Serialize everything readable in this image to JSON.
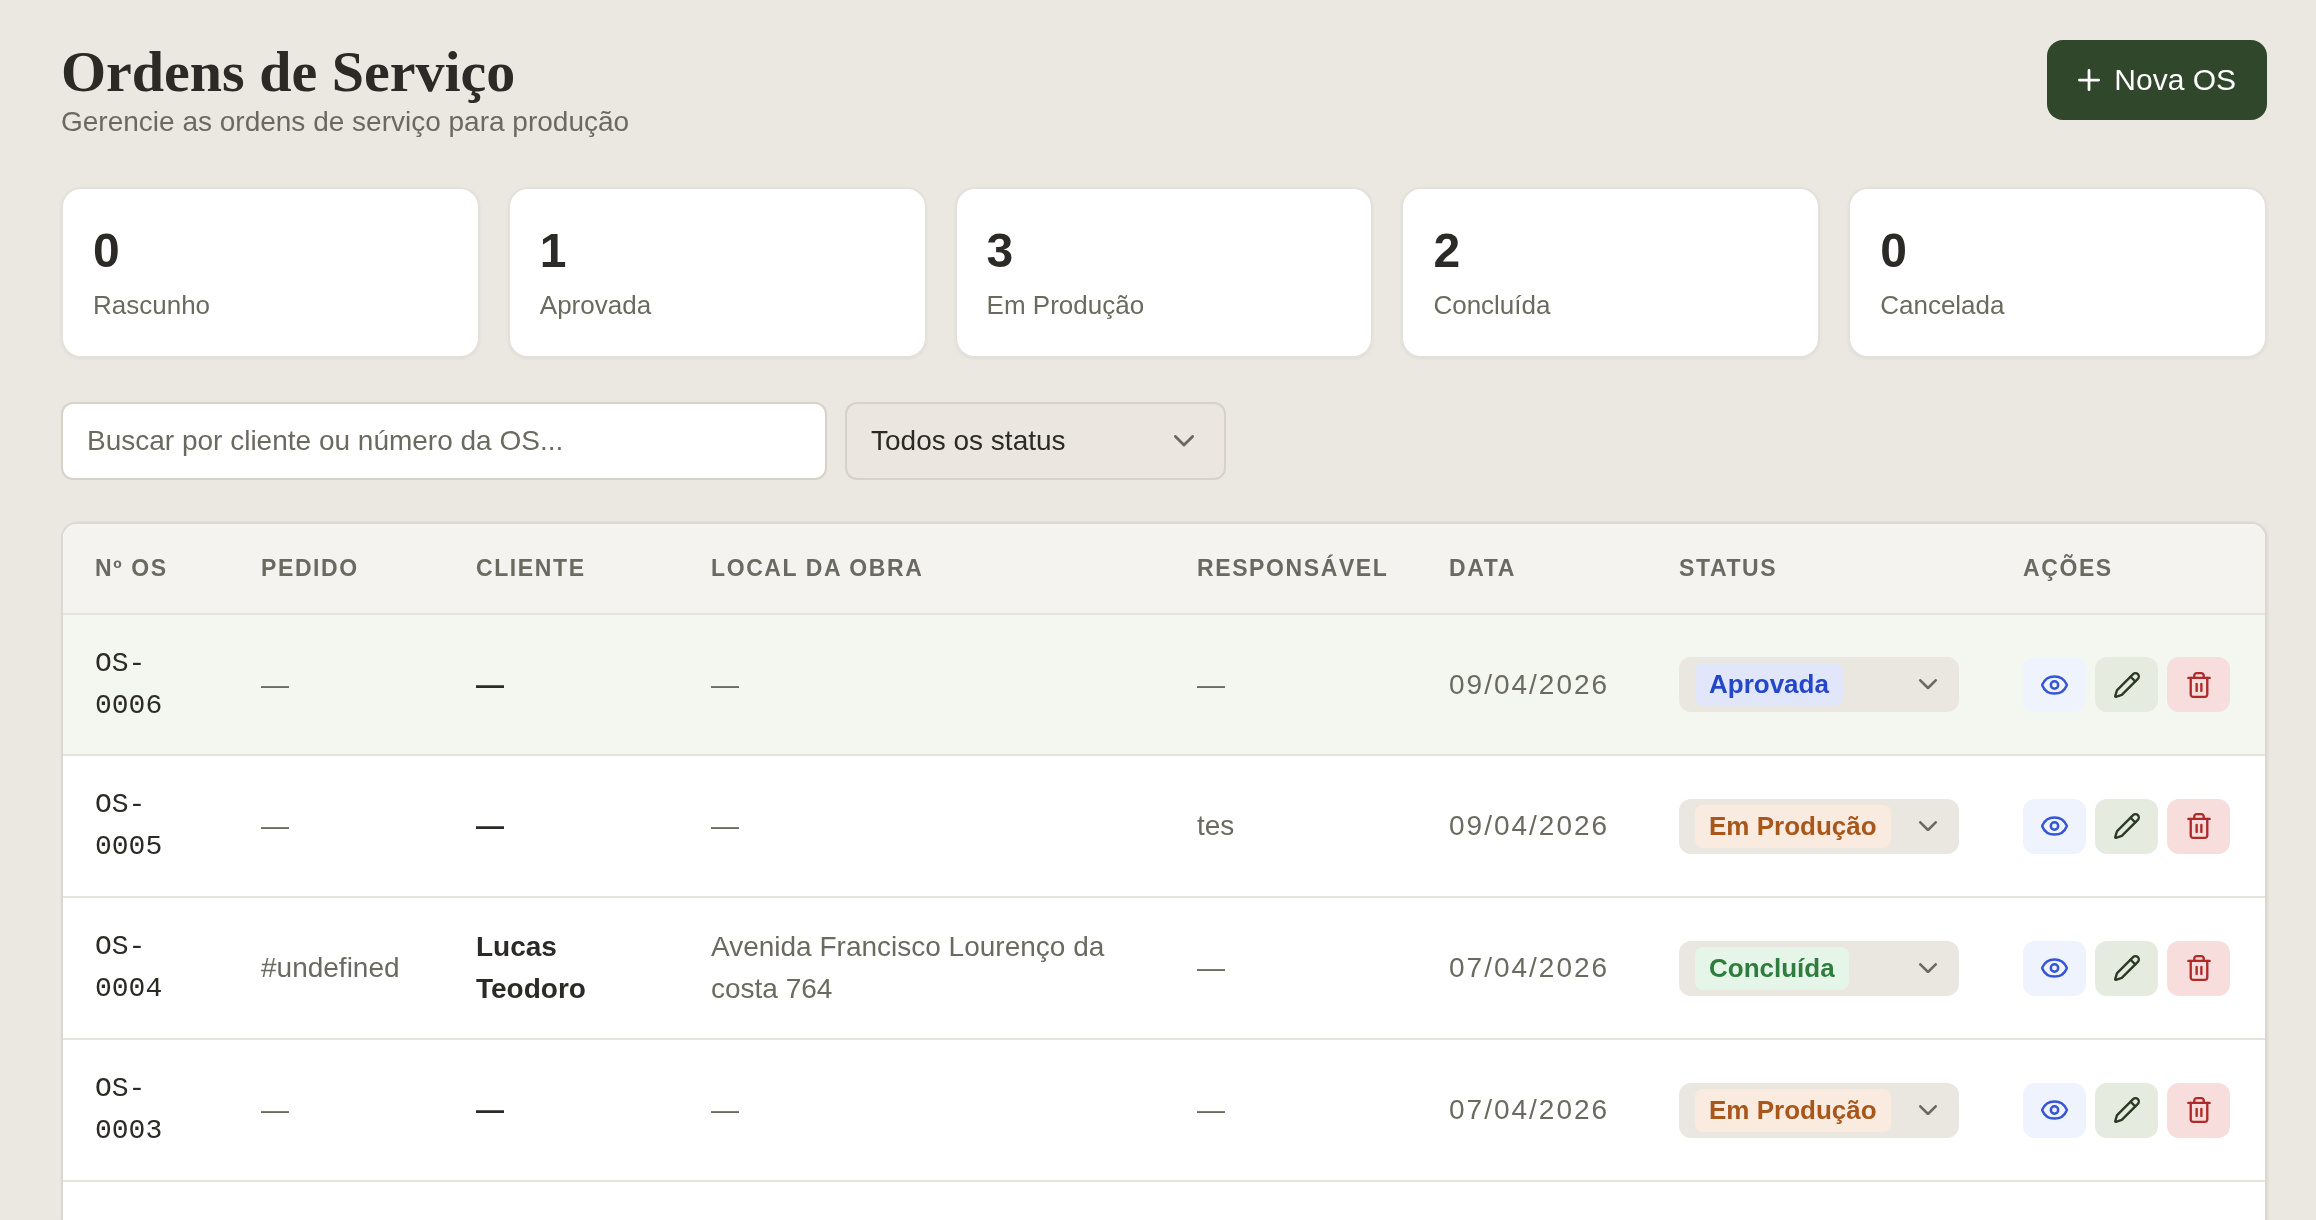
{
  "header": {
    "title": "Ordens de Serviço",
    "subtitle": "Gerencie as ordens de serviço para produção",
    "new_button": {
      "label": "Nova OS"
    }
  },
  "stats": [
    {
      "value": "0",
      "label": "Rascunho"
    },
    {
      "value": "1",
      "label": "Aprovada"
    },
    {
      "value": "3",
      "label": "Em Produção"
    },
    {
      "value": "2",
      "label": "Concluída"
    },
    {
      "value": "0",
      "label": "Cancelada"
    }
  ],
  "filters": {
    "search": {
      "placeholder": "Buscar por cliente ou número da OS..."
    },
    "status_filter": {
      "value": "Todos os status"
    }
  },
  "table": {
    "columns": [
      "Nº OS",
      "PEDIDO",
      "CLIENTE",
      "LOCAL DA OBRA",
      "RESPONSÁVEL",
      "DATA",
      "STATUS",
      "AÇÕES"
    ],
    "rows": [
      {
        "number": "OS-0006",
        "order": "—",
        "client": "—",
        "site": "—",
        "responsible": "—",
        "date": "09/04/2026",
        "status": {
          "label": "Aprovada",
          "color": "#2447c9"
        },
        "selected": true
      },
      {
        "number": "OS-0005",
        "order": "—",
        "client": "—",
        "site": "—",
        "responsible": "tes",
        "date": "09/04/2026",
        "status": {
          "label": "Em Produção",
          "color": "#a8561a"
        },
        "selected": false
      },
      {
        "number": "OS-0004",
        "order": "#undefined",
        "client": "Lucas Teodoro",
        "site": "Avenida Francisco Lourenço da costa 764",
        "responsible": "—",
        "date": "07/04/2026",
        "status": {
          "label": "Concluída",
          "color": "#2e7d3e"
        },
        "selected": false
      },
      {
        "number": "OS-0003",
        "order": "—",
        "client": "—",
        "site": "—",
        "responsible": "—",
        "date": "07/04/2026",
        "status": {
          "label": "Em Produção",
          "color": "#a8561a"
        },
        "selected": false
      }
    ]
  }
}
